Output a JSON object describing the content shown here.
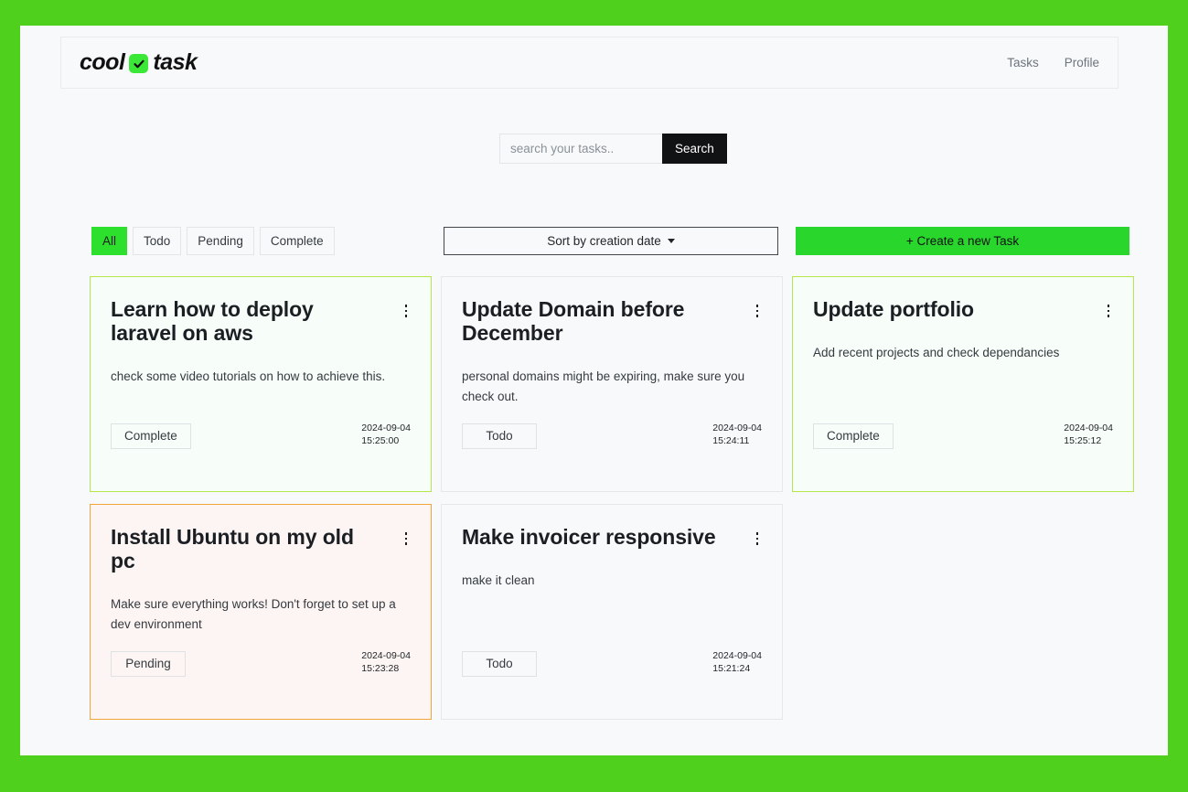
{
  "theme": {
    "page_background": "#4fd01c",
    "surface": "#f8f9fa",
    "accent_green": "#29d62b",
    "complete_border": "#b4e84c",
    "pending_border": "#f2a63a",
    "dark": "#111214"
  },
  "navbar": {
    "brand": {
      "first": "cool",
      "second": "task",
      "icon": "check-icon"
    },
    "links": [
      {
        "label": "Tasks"
      },
      {
        "label": "Profile"
      }
    ]
  },
  "search": {
    "placeholder": "search your tasks..",
    "value": "",
    "button_label": "Search"
  },
  "controls": {
    "filters": [
      {
        "label": "All",
        "active": true
      },
      {
        "label": "Todo",
        "active": false
      },
      {
        "label": "Pending",
        "active": false
      },
      {
        "label": "Complete",
        "active": false
      }
    ],
    "sort_label": "Sort by creation date",
    "create_label": "+ Create a new Task"
  },
  "tasks": [
    {
      "title": "Learn how to deploy laravel on aws",
      "description": "check some video tutorials on how to achieve this.",
      "status": "Complete",
      "status_key": "complete",
      "date": "2024-09-04",
      "time": "15:25:00"
    },
    {
      "title": "Update Domain before December",
      "description": "personal domains might be expiring, make sure you check out.",
      "status": "Todo",
      "status_key": "todo",
      "date": "2024-09-04",
      "time": "15:24:11"
    },
    {
      "title": "Update portfolio",
      "description": "Add recent projects and check dependancies",
      "status": "Complete",
      "status_key": "complete",
      "date": "2024-09-04",
      "time": "15:25:12"
    },
    {
      "title": "Install Ubuntu on my old pc",
      "description": "Make sure everything works! Don't forget to set up a dev environment",
      "status": "Pending",
      "status_key": "pending",
      "date": "2024-09-04",
      "time": "15:23:28"
    },
    {
      "title": "Make invoicer responsive",
      "description": "make it clean",
      "status": "Todo",
      "status_key": "todo",
      "date": "2024-09-04",
      "time": "15:21:24"
    }
  ]
}
